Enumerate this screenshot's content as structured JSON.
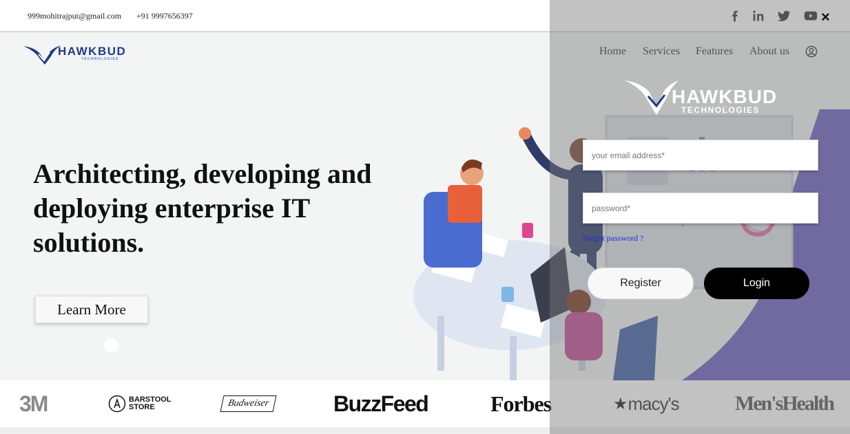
{
  "topbar": {
    "email": "999mohitrajput@gmail.com",
    "phone": "+91 9997656397",
    "social_icons": [
      "facebook-icon",
      "linkedin-icon",
      "twitter-icon",
      "youtube-icon"
    ]
  },
  "logo": {
    "name": "HAWKBUD",
    "tagline": "TECHNOLOGIES"
  },
  "nav": {
    "items": [
      {
        "label": "Home"
      },
      {
        "label": "Services"
      },
      {
        "label": "Features"
      },
      {
        "label": "About us"
      }
    ],
    "user_icon": "user-circle-icon"
  },
  "hero": {
    "title": "Architecting, developing and deploying enterprise IT solutions.",
    "cta": "Learn More"
  },
  "brands": [
    "3M",
    "BARSTOOL STORE",
    "Budweiser",
    "BuzzFeed",
    "Forbes",
    "macy's",
    "Men'sHealth"
  ],
  "login": {
    "close": "×",
    "email_placeholder": "your email address*",
    "password_placeholder": "password*",
    "forgot": "Forgot password ?",
    "register": "Register",
    "login": "Login"
  },
  "colors": {
    "accent_purple": "#6b5fc4",
    "logo_blue": "#1e3a8a",
    "link_blue": "#1a2fd6"
  }
}
